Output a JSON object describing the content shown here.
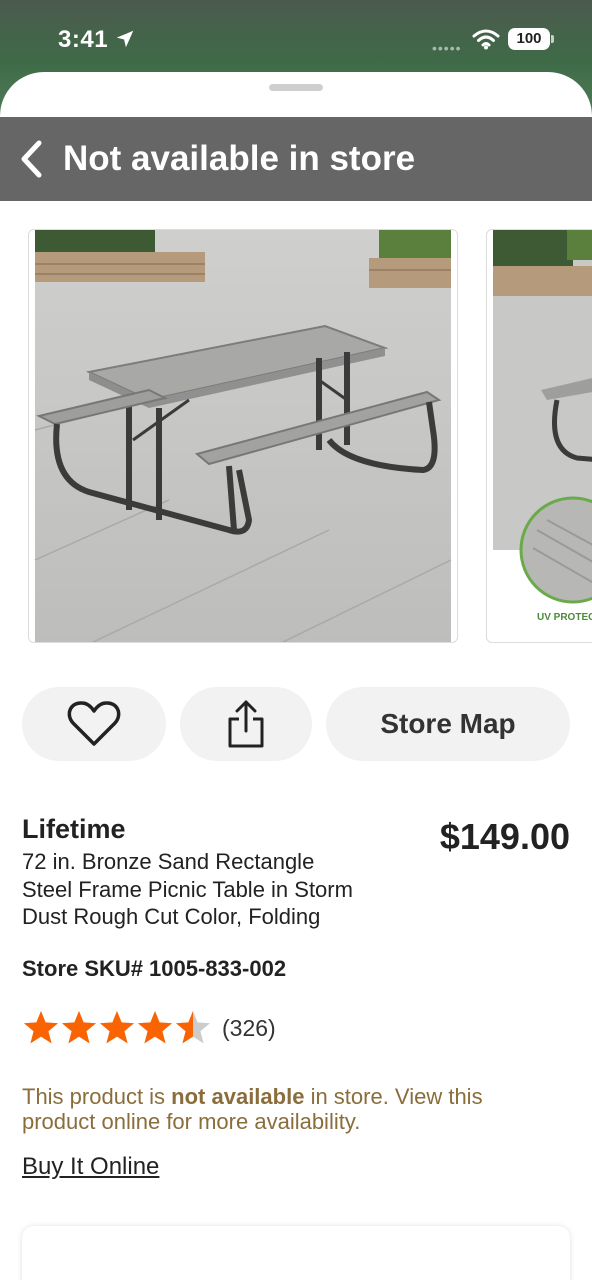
{
  "status_bar": {
    "time": "3:41",
    "battery": "100"
  },
  "nav": {
    "title": "Not available in store"
  },
  "gallery": {
    "images": [
      {
        "name": "picnic-table-photo"
      },
      {
        "name": "picnic-table-detail-photo",
        "caption": "UV PROTECT"
      }
    ]
  },
  "actions": {
    "store_map_label": "Store Map"
  },
  "product": {
    "brand": "Lifetime",
    "price": "$149.00",
    "description": "72 in. Bronze Sand Rectangle Steel Frame Picnic Table in Storm Dust Rough Cut Color, Folding",
    "sku_label": "Store SKU#",
    "sku_value": "1005-833-002",
    "rating": 4.5,
    "review_count": "(326)"
  },
  "availability": {
    "text_before": "This product is ",
    "text_bold": "not available",
    "text_after": " in store. View this product online for more availability.",
    "buy_online_label": "Buy It Online"
  },
  "colors": {
    "star": "#f96302",
    "notice": "#8a6d3b",
    "nav_bg": "#666666"
  }
}
